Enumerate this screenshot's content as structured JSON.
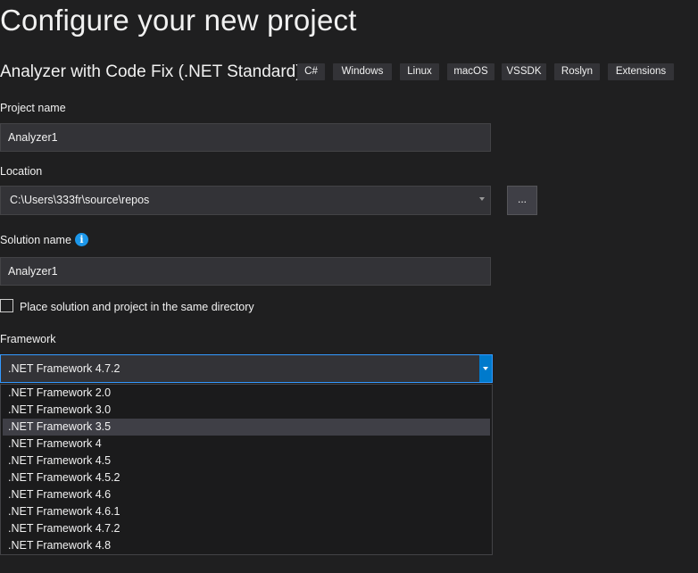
{
  "page": {
    "title": "Configure your new project",
    "template_name": "Analyzer with Code Fix (.NET Standard)",
    "tags": [
      "C#",
      "Windows",
      "Linux",
      "macOS",
      "VSSDK",
      "Roslyn",
      "Extensions"
    ]
  },
  "project_name": {
    "label": "Project name",
    "value": "Analyzer1"
  },
  "location": {
    "label": "Location",
    "value": "C:\\Users\\333fr\\source\\repos",
    "browse_label": "..."
  },
  "solution_name": {
    "label": "Solution name",
    "value": "Analyzer1",
    "info_glyph": "i"
  },
  "same_directory": {
    "label": "Place solution and project in the same directory",
    "checked": false
  },
  "framework": {
    "label": "Framework",
    "selected": ".NET Framework 4.7.2",
    "highlighted": ".NET Framework 3.5",
    "options": [
      ".NET Framework 2.0",
      ".NET Framework 3.0",
      ".NET Framework 3.5",
      ".NET Framework 4",
      ".NET Framework 4.5",
      ".NET Framework 4.5.2",
      ".NET Framework 4.6",
      ".NET Framework 4.6.1",
      ".NET Framework 4.7.2",
      ".NET Framework 4.8"
    ]
  },
  "colors": {
    "background": "#1f1f20",
    "field": "#333337",
    "accent": "#007acc",
    "focus_border": "#3399ff",
    "info": "#1c97ea",
    "highlight": "#3f3f46"
  }
}
